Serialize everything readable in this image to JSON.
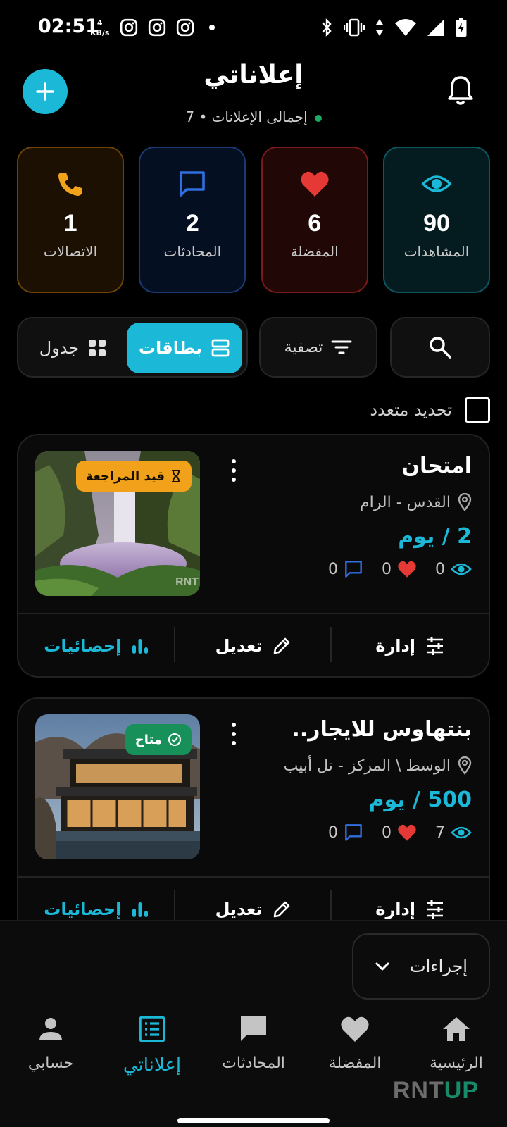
{
  "status_bar": {
    "time": "02:51",
    "net_speed_value": "4",
    "net_speed_unit": "KB/s"
  },
  "header": {
    "title": "إعلاناتي",
    "subtitle": "إجمالى الإعلانات • 7"
  },
  "stats": [
    {
      "label": "المشاهدات",
      "value": "90",
      "icon": "eye-icon",
      "color": "#1cb8d8"
    },
    {
      "label": "المفضلة",
      "value": "6",
      "icon": "heart-icon",
      "color": "#e53935"
    },
    {
      "label": "المحادثات",
      "value": "2",
      "icon": "chat-icon",
      "color": "#2f6fe0"
    },
    {
      "label": "الاتصالات",
      "value": "1",
      "icon": "phone-icon",
      "color": "#f1a21a"
    }
  ],
  "toolbar": {
    "filter_label": "تصفية",
    "cards_label": "بطاقات",
    "table_label": "جدول"
  },
  "multi_select_label": "تحديد متعدد",
  "listings": [
    {
      "title": "امتحان",
      "location": "القدس - الرام",
      "price": "2 / يوم",
      "status": "قيد المراجعة",
      "views": "0",
      "favorites": "0",
      "chats": "0",
      "watermark": "RNT"
    },
    {
      "title": "بنتهاوس للايجار..",
      "location": "الوسط \\ المركز - تل أبيب",
      "price": "500 / يوم",
      "status": "متاح",
      "views": "7",
      "favorites": "0",
      "chats": "0"
    }
  ],
  "listing_actions": {
    "manage": "إدارة",
    "edit": "تعديل",
    "stats": "إحصائيات"
  },
  "actions_dropdown_label": "إجراءات",
  "bottom_nav": [
    {
      "label": "الرئيسية",
      "icon": "home-icon"
    },
    {
      "label": "المفضلة",
      "icon": "heart-icon"
    },
    {
      "label": "المحادثات",
      "icon": "chat-icon"
    },
    {
      "label": "إعلاناتي",
      "icon": "list-icon",
      "active": true
    },
    {
      "label": "حسابي",
      "icon": "person-icon"
    }
  ],
  "brand": {
    "part1": "RNT",
    "part2": "UP"
  },
  "colors": {
    "accent": "#1cb8d8",
    "pending": "#f1a21a",
    "available": "#18905a",
    "danger": "#e53935"
  }
}
